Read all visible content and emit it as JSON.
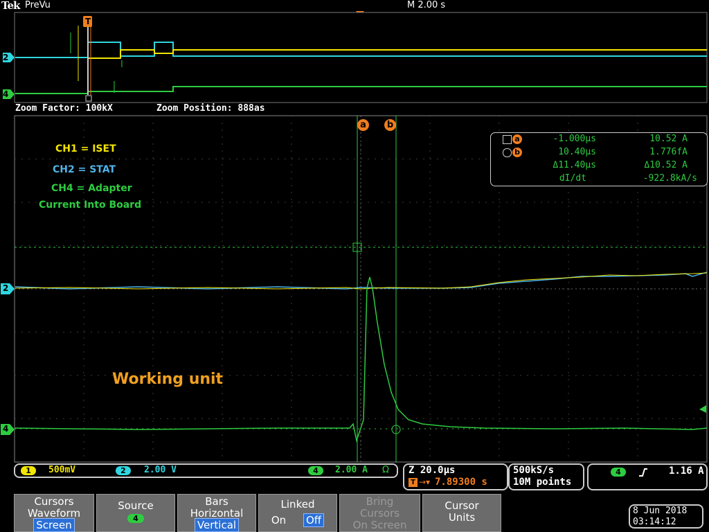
{
  "header": {
    "brand": "Tek",
    "mode": "PreVu",
    "timebase": "M 2.00 s"
  },
  "zoom": {
    "factor_label": "Zoom Factor: 100kX",
    "position_label": "Zoom Position: 888as"
  },
  "annotations": {
    "ch1": "CH1 = ISET",
    "ch2": "CH2 = STAT",
    "ch4_line1": "CH4 = Adapter",
    "ch4_line2": "Current Into Board",
    "status": "Working unit"
  },
  "markers": {
    "trigger": "T",
    "cursor_a": "a",
    "cursor_b": "b",
    "ch2": "2",
    "ch4": "4"
  },
  "readout": {
    "a_time": "-1.000µs",
    "a_value": "10.52 A",
    "b_time": "10.40µs",
    "b_value": "1.776fA",
    "delta_time": "Δ11.40µs",
    "delta_value": "Δ10.52 A",
    "slope_label": "dI/dt",
    "slope_value": "-922.8kA/s"
  },
  "channels": {
    "ch1_num": "1",
    "ch1_scale": "500mV",
    "ch2_num": "2",
    "ch2_scale": "2.00 V",
    "ch4_num": "4",
    "ch4_scale": "2.00 A",
    "ch4_unit": "Ω",
    "colors": {
      "ch1": "#f2e600",
      "ch2": "#2fd6e0",
      "ch4": "#2ecc40",
      "accent": "#f07d1e"
    }
  },
  "horizontal": {
    "scale": "Z 20.0µs",
    "trigger_delay": "7.89300 s",
    "sample_rate": "500kS/s",
    "record_length": "10M points"
  },
  "trigger": {
    "source": "4",
    "slope_icon": "rising-edge-icon",
    "level": "1.16 A"
  },
  "menu": {
    "cursors": {
      "line1": "Cursors",
      "line2": "Waveform",
      "selected": "Screen"
    },
    "source": {
      "label": "Source",
      "value": "4"
    },
    "bars": {
      "line1": "Bars",
      "line2": "Horizontal",
      "selected": "Vertical"
    },
    "linked": {
      "label": "Linked",
      "on": "On",
      "off": "Off"
    },
    "bring": {
      "line1": "Bring",
      "line2": "Cursors",
      "line3": "On Screen"
    },
    "units": {
      "line1": "Cursor",
      "line2": "Units"
    }
  },
  "datetime": {
    "date": "8 Jun 2018",
    "time": "03:14:12"
  }
}
